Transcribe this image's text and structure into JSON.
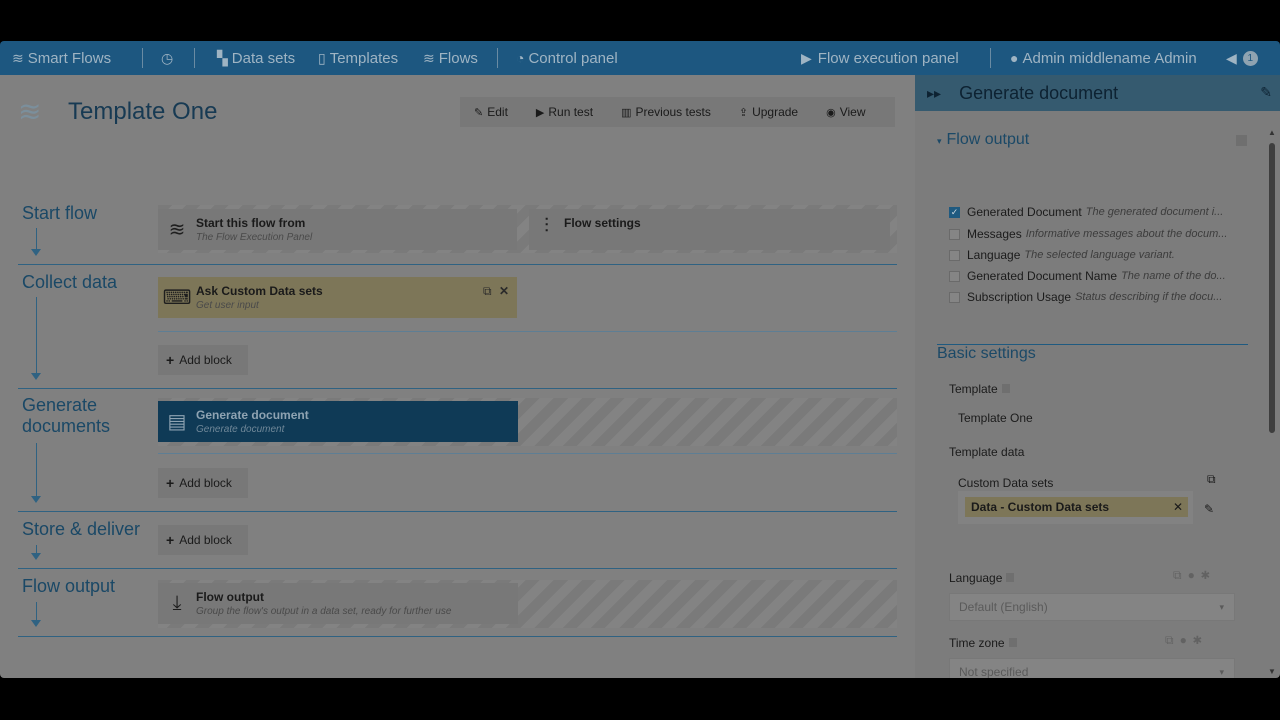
{
  "nav": {
    "brand": "Smart Flows",
    "datasets": "Data sets",
    "templates": "Templates",
    "flows": "Flows",
    "control_panel": "Control panel",
    "flow_execution_panel": "Flow execution panel",
    "user": "Admin middlename Admin",
    "notification_count": "1"
  },
  "page": {
    "title": "Template One",
    "toolbar": {
      "edit": "Edit",
      "run_test": "Run test",
      "previous_tests": "Previous tests",
      "upgrade": "Upgrade",
      "view": "View"
    }
  },
  "stages": [
    {
      "label": "Start flow"
    },
    {
      "label": "Collect data"
    },
    {
      "label": "Generate documents"
    },
    {
      "label": "Store & deliver"
    },
    {
      "label": "Flow output"
    }
  ],
  "blocks": {
    "start_from": {
      "title": "Start this flow from",
      "subtitle": "The Flow Execution Panel"
    },
    "flow_settings": {
      "title": "Flow settings"
    },
    "ask_datasets": {
      "title": "Ask Custom Data sets",
      "subtitle": "Get user input"
    },
    "generate_doc": {
      "title": "Generate document",
      "subtitle": "Generate document"
    },
    "flow_output": {
      "title": "Flow output",
      "subtitle": "Group the flow's output in a data set, ready for further use"
    },
    "add_block_label": "Add block"
  },
  "side": {
    "header": "Generate document",
    "flow_output_title": "Flow output",
    "outputs": [
      {
        "name": "Generated Document",
        "desc": "The generated document i...",
        "checked": true
      },
      {
        "name": "Messages",
        "desc": "Informative messages about the docum...",
        "checked": false
      },
      {
        "name": "Language",
        "desc": "The selected language variant.",
        "checked": false
      },
      {
        "name": "Generated Document Name",
        "desc": "The name of the do...",
        "checked": false
      },
      {
        "name": "Subscription Usage",
        "desc": "Status describing if the docu...",
        "checked": false
      }
    ],
    "basic_settings_title": "Basic settings",
    "template_label": "Template",
    "template_value": "Template One",
    "template_data_label": "Template data",
    "custom_datasets_label": "Custom Data sets",
    "tag": "Data - Custom Data sets",
    "language_label": "Language",
    "language_placeholder": "Default (English)",
    "timezone_label": "Time zone",
    "timezone_placeholder": "Not specified"
  }
}
